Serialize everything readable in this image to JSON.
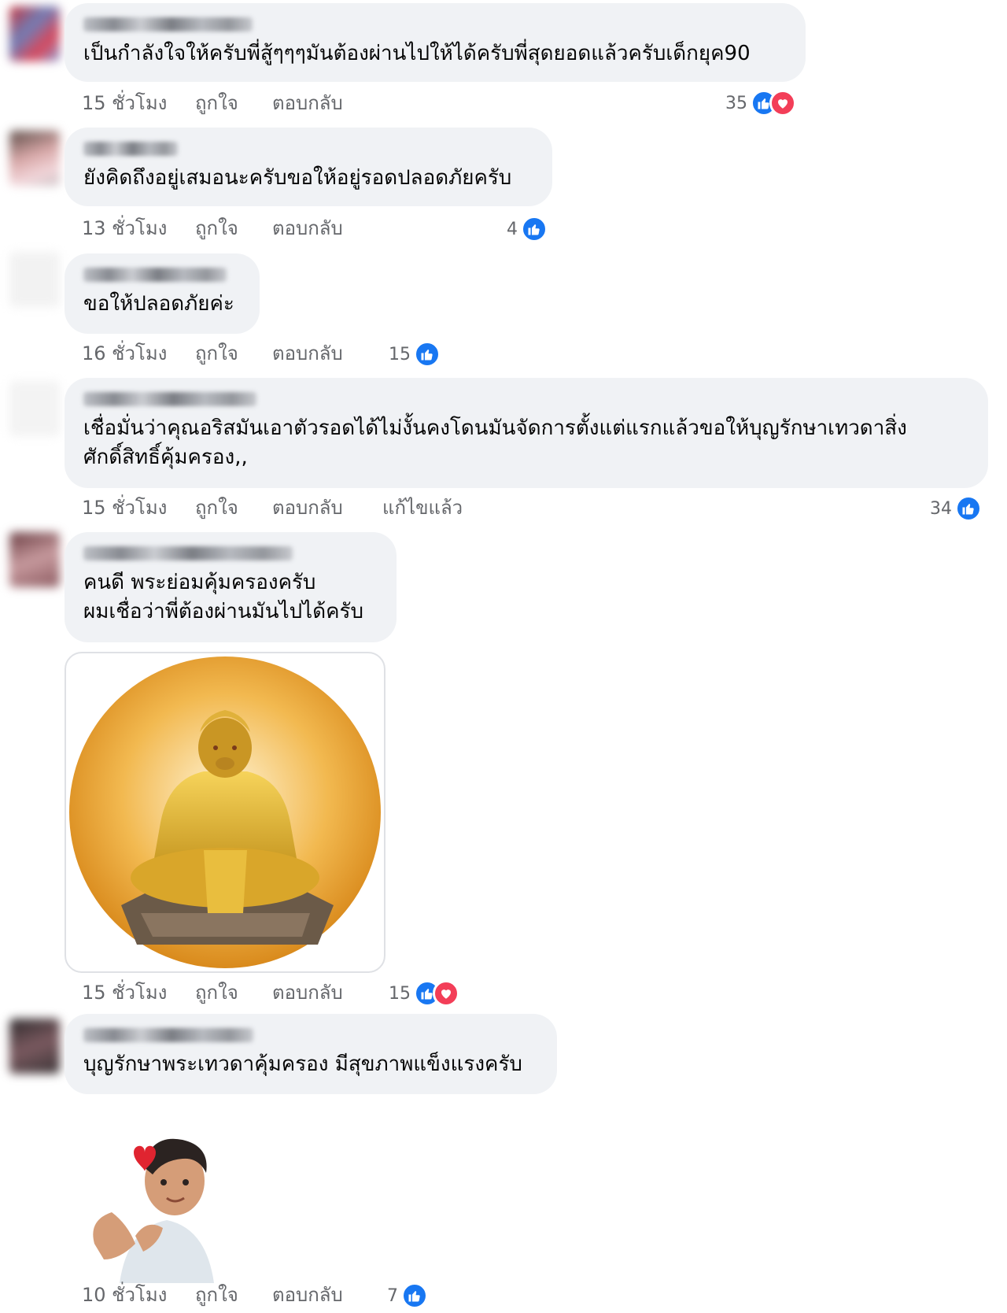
{
  "colors": {
    "bubble": "#f0f2f5",
    "meta_text": "#65676b",
    "like": "#1877f2",
    "love": "#f33e58"
  },
  "icons": {
    "like": "like-icon",
    "love": "love-icon"
  },
  "comments": [
    {
      "text": "เป็นกำลังใจให้ครับพี่สู้ๆๆๆมันต้องผ่านไปให้ได้ครับพี่สุดยอดแล้วครับเด็กยุค90",
      "time": "15 ชั่วโมง",
      "like_label": "ถูกใจ",
      "reply_label": "ตอบกลับ",
      "reactions": "35"
    },
    {
      "text": "ยังคิดถึงอยู่เสมอนะครับขอให้อยู่รอดปลอดภัยครับ",
      "time": "13 ชั่วโมง",
      "like_label": "ถูกใจ",
      "reply_label": "ตอบกลับ",
      "reactions": "4"
    },
    {
      "text": "ขอให้ปลอดภัยค่ะ",
      "time": "16 ชั่วโมง",
      "like_label": "ถูกใจ",
      "reply_label": "ตอบกลับ",
      "reactions": "15"
    },
    {
      "text": "เชื่อมั่นว่าคุณอริสมันเอาตัวรอดได้ไม่งั้นคงโดนมันจัดการตั้งแต่แรกแล้วขอให้บุญรักษาเทวดาสิ่งศักดิ์สิทธิ์คุ้มครอง,,",
      "time": "15 ชั่วโมง",
      "like_label": "ถูกใจ",
      "reply_label": "ตอบกลับ",
      "edited_label": "แก้ไขแล้ว",
      "reactions": "34"
    },
    {
      "text": "คนดี พระย่อมคุ้มครองครับ\nผมเชื่อว่าพี่ต้องผ่านมันไปได้ครับ",
      "time": "15 ชั่วโมง",
      "like_label": "ถูกใจ",
      "reply_label": "ตอบกลับ",
      "reactions": "15"
    },
    {
      "text": "บุญรักษาพระเทวดาคุ้มครอง มีสุขภาพแข็งแรงครับ",
      "time": "10 ชั่วโมง",
      "like_label": "ถูกใจ",
      "reply_label": "ตอบกลับ",
      "reactions": "7"
    }
  ]
}
